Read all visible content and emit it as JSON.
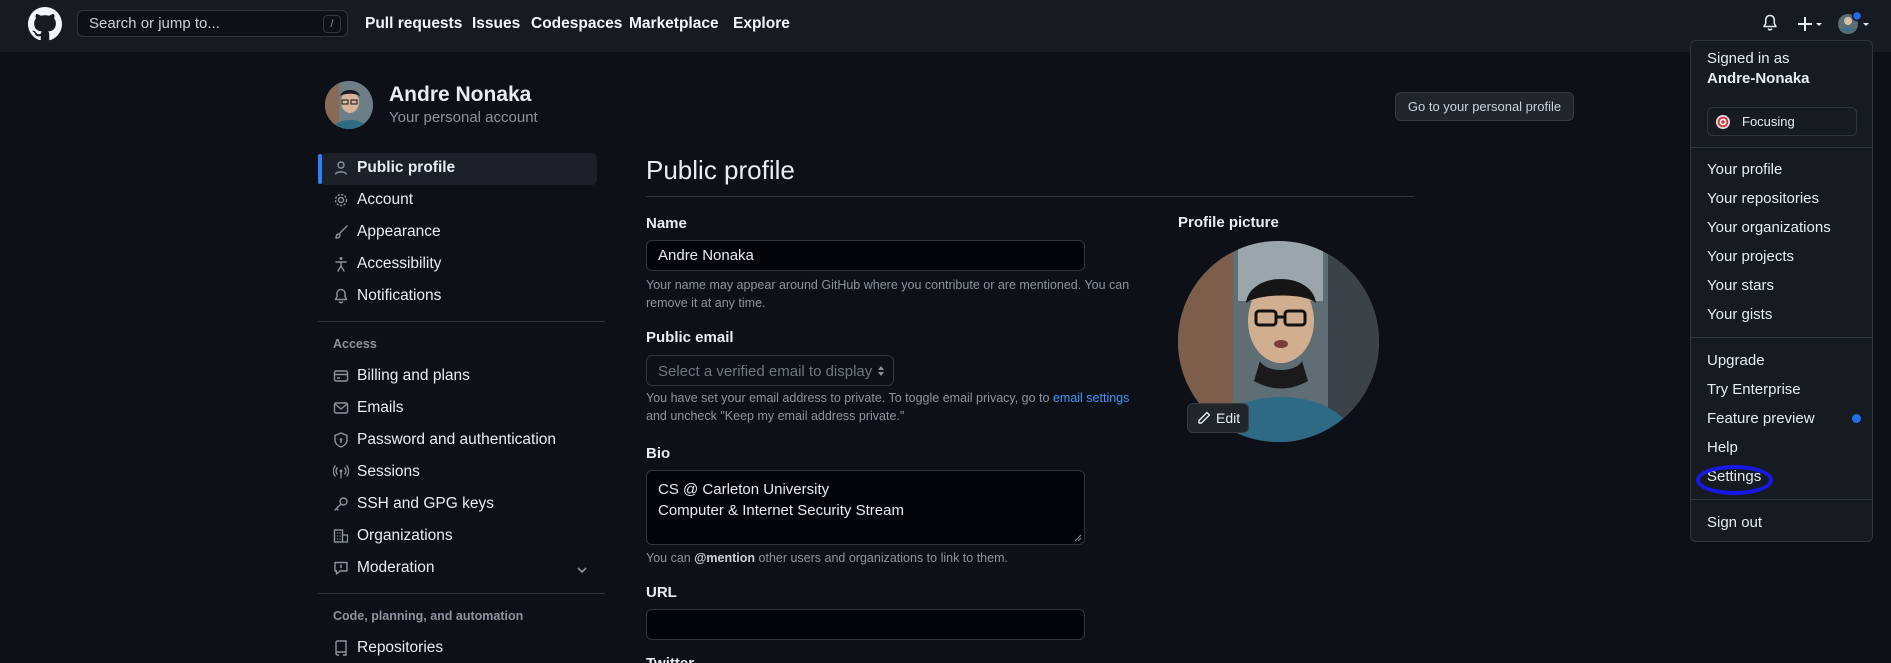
{
  "header": {
    "search_placeholder": "Search or jump to...",
    "search_shortcut": "/",
    "nav": [
      "Pull requests",
      "Issues",
      "Codespaces",
      "Marketplace",
      "Explore"
    ]
  },
  "dropdown": {
    "signed_in_as": "Signed in as",
    "username": "Andre-Nonaka",
    "status": "Focusing",
    "group1": [
      "Your profile",
      "Your repositories",
      "Your organizations",
      "Your projects",
      "Your stars",
      "Your gists"
    ],
    "group2": [
      "Upgrade",
      "Try Enterprise",
      "Feature preview",
      "Help",
      "Settings"
    ],
    "sign_out": "Sign out"
  },
  "profile": {
    "name": "Andre Nonaka",
    "subtitle": "Your personal account",
    "go_to_profile": "Go to your personal profile"
  },
  "sidebar": {
    "items_top": [
      "Public profile",
      "Account",
      "Appearance",
      "Accessibility",
      "Notifications"
    ],
    "access_heading": "Access",
    "items_access": [
      "Billing and plans",
      "Emails",
      "Password and authentication",
      "Sessions",
      "SSH and GPG keys",
      "Organizations",
      "Moderation"
    ],
    "code_heading": "Code, planning, and automation",
    "items_code": [
      "Repositories"
    ]
  },
  "main": {
    "title": "Public profile",
    "name_label": "Name",
    "name_value": "Andre Nonaka",
    "name_note_1": "Your name may appear around GitHub where you contribute or are mentioned. You can",
    "name_note_2": "remove it at any time.",
    "email_label": "Public email",
    "email_placeholder": "Select a verified email to display",
    "email_note_1": "You have set your email address to private. To toggle email privacy, go to",
    "email_note_link": "email settings",
    "email_note_2": "and uncheck \"Keep my email address private.\"",
    "bio_label": "Bio",
    "bio_line1": "CS @ Carleton University",
    "bio_line2": "Computer & Internet Security Stream",
    "bio_note_a": "You can",
    "bio_note_mention": "@mention",
    "bio_note_b": "other users and organizations to link to them.",
    "url_label": "URL",
    "url_value": "",
    "next_label_partial": "Twitter"
  },
  "profile_picture": {
    "label": "Profile picture",
    "edit": "Edit"
  },
  "colors": {
    "accent": "#2f81f7",
    "link": "#4493f8",
    "annotation": "#1818e8"
  }
}
